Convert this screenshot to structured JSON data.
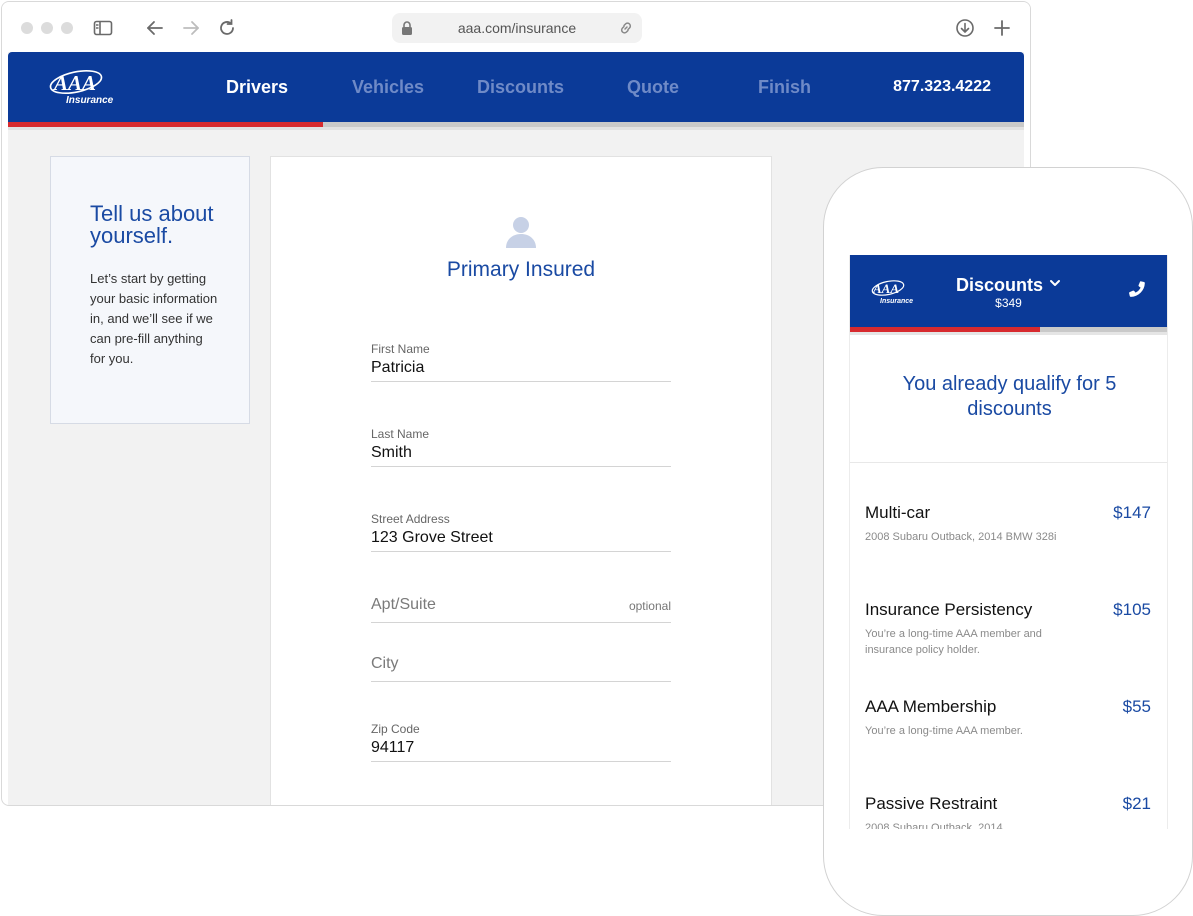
{
  "browser": {
    "url": "aaa.com/insurance"
  },
  "site": {
    "logo_text": "AAA",
    "logo_sub": "Insurance",
    "nav": [
      {
        "label": "Drivers",
        "active": true
      },
      {
        "label": "Vehicles",
        "active": false
      },
      {
        "label": "Discounts",
        "active": false
      },
      {
        "label": "Quote",
        "active": false
      },
      {
        "label": "Finish",
        "active": false
      }
    ],
    "phone": "877.323.4222",
    "progress_fraction": 0.31
  },
  "intro": {
    "title": "Tell us about yourself.",
    "body": "Let’s start by getting your basic information in, and we’ll see if we can pre-fill anything for you."
  },
  "form": {
    "title": "Primary Insured",
    "fields": [
      {
        "label": "First Name",
        "value": "Patricia"
      },
      {
        "label": "Last Name",
        "value": "Smith"
      },
      {
        "label": "Street Address",
        "value": "123 Grove Street"
      },
      {
        "placeholder": "Apt/Suite",
        "hint": "optional"
      },
      {
        "placeholder": "City"
      },
      {
        "label": "Zip Code",
        "value": "94117"
      }
    ]
  },
  "mobile": {
    "logo_text": "AAA",
    "logo_sub": "Insurance",
    "title": "Discounts",
    "subtitle": "$349",
    "progress_fraction": 0.6,
    "headline": "You already qualify for 5 discounts",
    "discounts": [
      {
        "name": "Multi-car",
        "amount": "$147",
        "desc": "2008 Subaru Outback, 2014 BMW 328i"
      },
      {
        "name": "Insurance Persistency",
        "amount": "$105",
        "desc": "You’re a long-time AAA member and insurance policy holder."
      },
      {
        "name": "AAA Membership",
        "amount": "$55",
        "desc": "You’re a long-time AAA member."
      },
      {
        "name": "Passive Restraint",
        "amount": "$21",
        "desc": "2008 Subaru Outback, 2014"
      }
    ]
  },
  "colors": {
    "brand_blue": "#0b3a98",
    "accent_red": "#d72a2e",
    "link_blue": "#1a4aa3"
  }
}
